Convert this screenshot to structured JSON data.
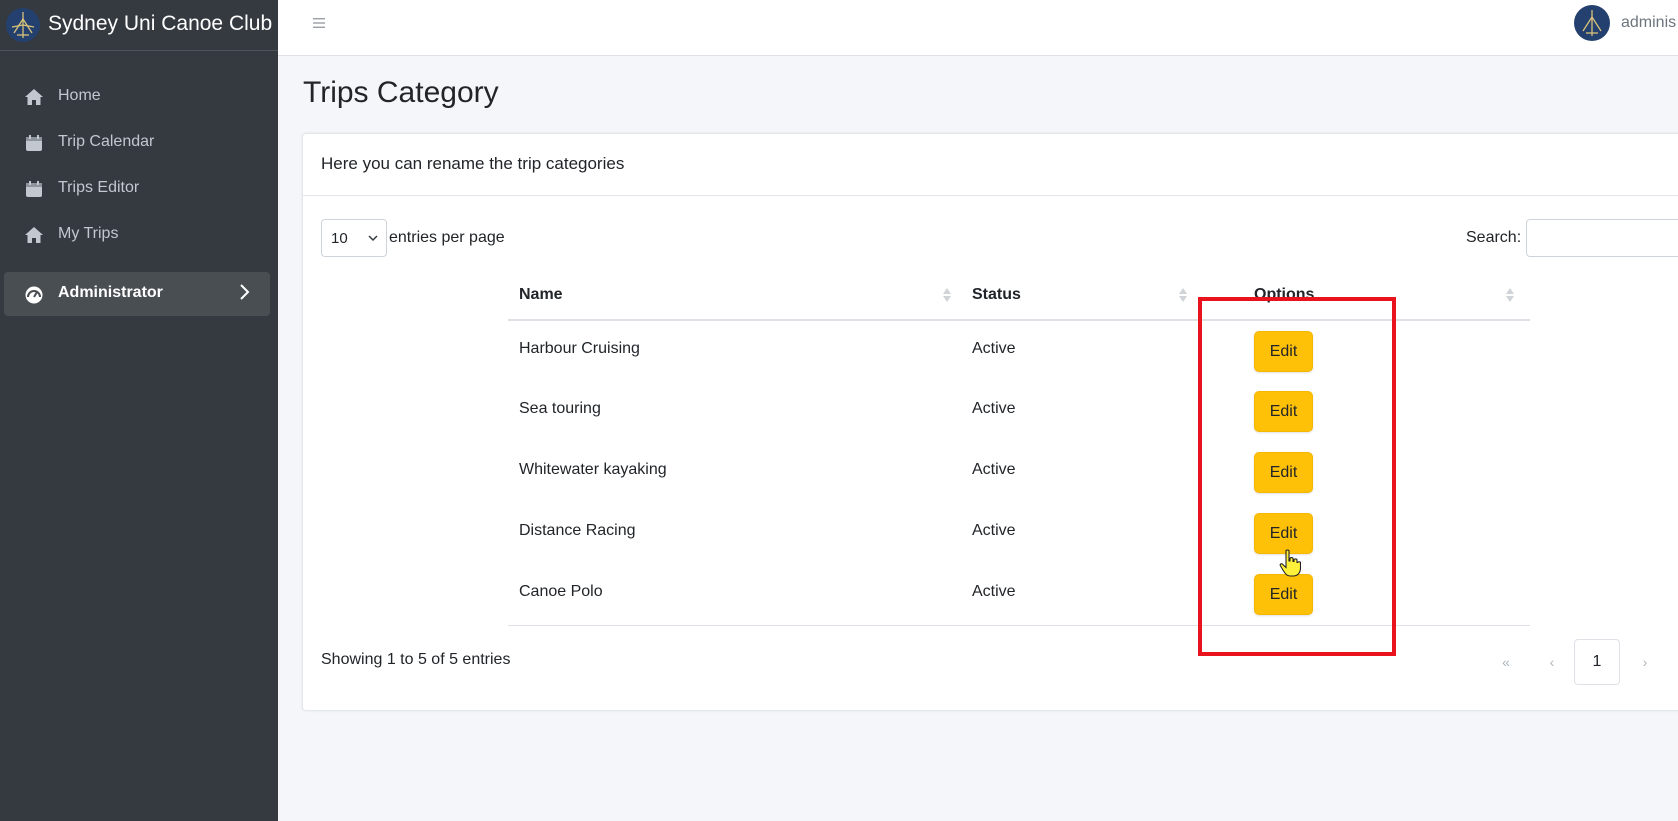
{
  "brand": {
    "name": "Sydney Uni Canoe Club",
    "logo_icon": "canoe-club-logo-icon"
  },
  "topbar": {
    "menu_icon": "hamburger-icon",
    "user_name": "adminis"
  },
  "sidebar": {
    "items": [
      {
        "label": "Home",
        "icon": "home-icon"
      },
      {
        "label": "Trip Calendar",
        "icon": "calendar-icon"
      },
      {
        "label": "Trips Editor",
        "icon": "calendar-icon"
      },
      {
        "label": "My Trips",
        "icon": "home-icon"
      },
      {
        "label": "Administrator",
        "icon": "dashboard-gauge-icon",
        "active": true
      }
    ]
  },
  "page": {
    "title": "Trips Category"
  },
  "card": {
    "header_text": "Here you can rename the trip categories",
    "per_page_value": "10",
    "per_page_label": "entries per page",
    "search_label": "Search:",
    "search_value": ""
  },
  "table": {
    "columns": [
      "Name",
      "Status",
      "Options"
    ],
    "rows": [
      {
        "name": "Harbour Cruising",
        "status": "Active",
        "action": "Edit"
      },
      {
        "name": "Sea touring",
        "status": "Active",
        "action": "Edit"
      },
      {
        "name": "Whitewater kayaking",
        "status": "Active",
        "action": "Edit"
      },
      {
        "name": "Distance Racing",
        "status": "Active",
        "action": "Edit"
      },
      {
        "name": "Canoe Polo",
        "status": "Active",
        "action": "Edit"
      }
    ]
  },
  "footer": {
    "showing": "Showing 1 to 5 of 5 entries"
  },
  "pagination": {
    "first": "«",
    "prev": "‹",
    "current": "1",
    "next": "›"
  },
  "colors": {
    "sidebar": "#343a40",
    "edit_button": "#ffc107",
    "highlight": "#e8131c"
  }
}
